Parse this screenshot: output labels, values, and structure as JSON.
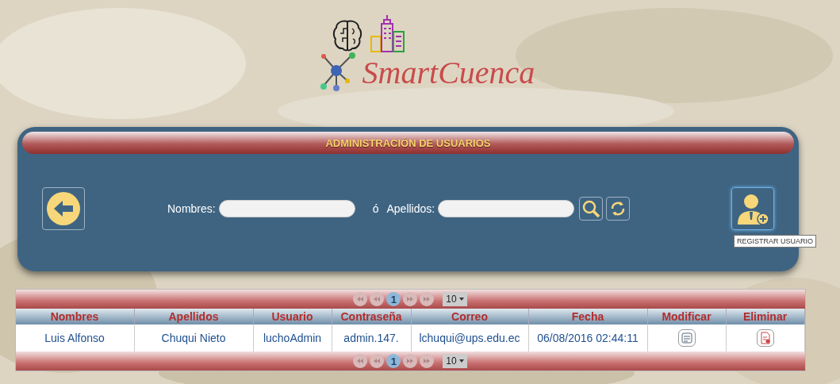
{
  "logo": {
    "title": "SmartCuenca"
  },
  "panel": {
    "title": "ADMINISTRACIÓN DE USUARIOS",
    "fields": [
      {
        "label": "Nombres:"
      },
      {
        "label": "Apellidos:"
      }
    ],
    "separator": "ó",
    "tooltip": "REGISTRAR USUARIO"
  },
  "table": {
    "paginators": [
      {
        "pages": [
          {
            "label": "1",
            "selected": true
          }
        ],
        "page_size": "10"
      },
      {
        "pages": [
          {
            "label": "1",
            "selected": true
          }
        ],
        "page_size": "10"
      }
    ],
    "columns": [
      "Nombres",
      "Apellidos",
      "Usuario",
      "Contraseña",
      "Correo",
      "Fecha",
      "Modificar",
      "Eliminar"
    ],
    "rows": [
      {
        "cells": [
          "Luis Alfonso",
          "Chuqui Nieto",
          "luchoAdmin",
          "admin.147.",
          "lchuqui@ups.edu.ec",
          "06/08/2016 02:44:11"
        ]
      }
    ]
  }
}
